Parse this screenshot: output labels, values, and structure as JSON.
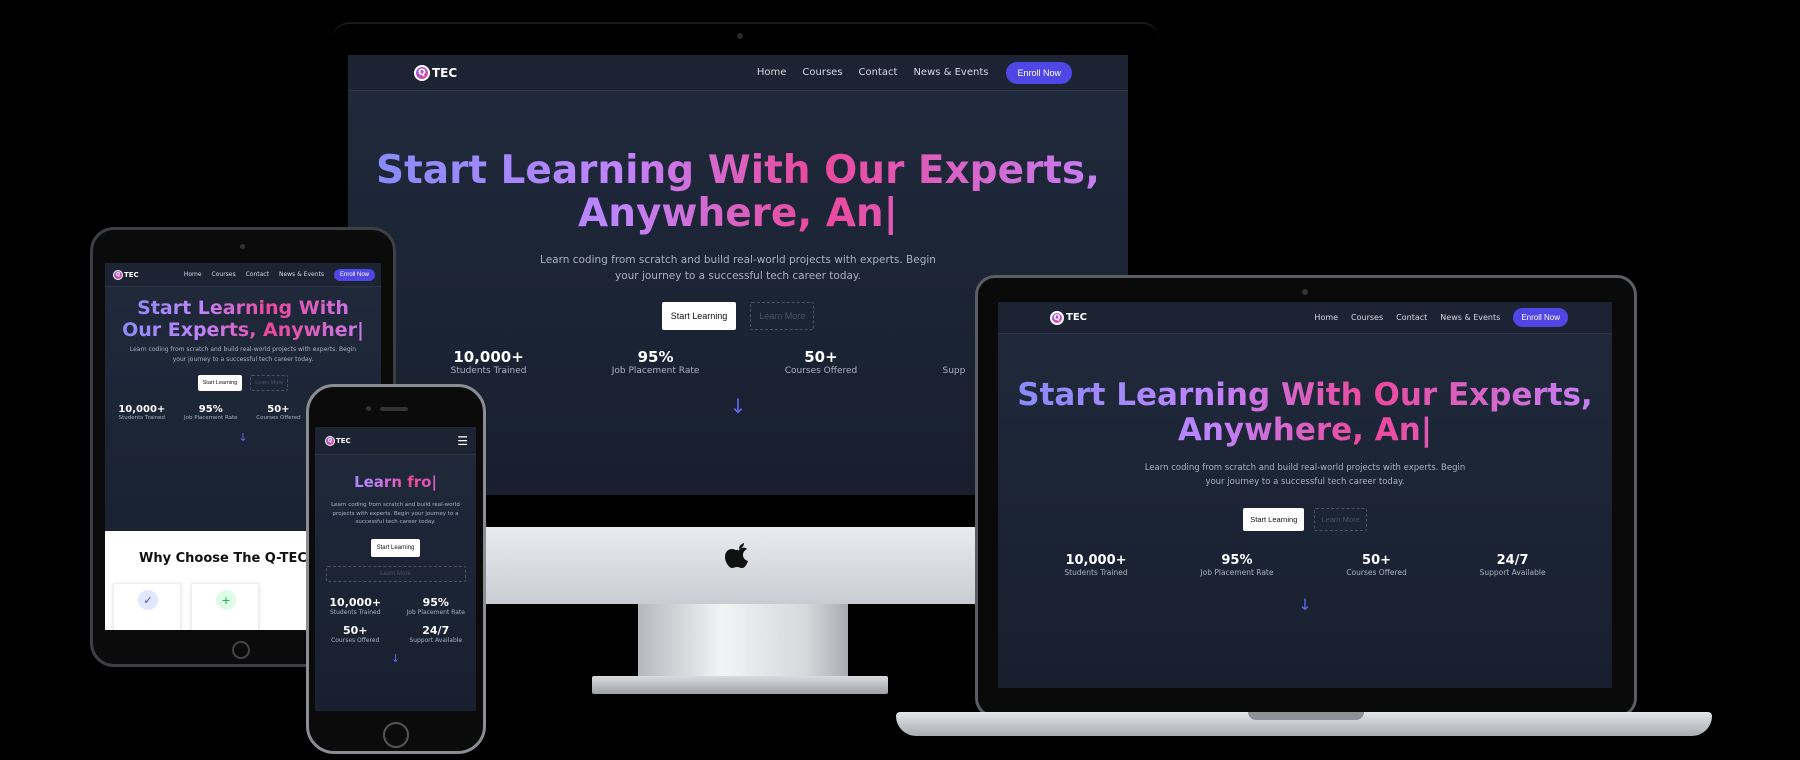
{
  "site": {
    "logo_text": "TEC",
    "logo_letter": "Q",
    "nav": [
      "Home",
      "Courses",
      "Contact",
      "News & Events"
    ],
    "enroll_label": "Enroll Now",
    "hero_full": "Start Learning With Our Experts, Anywhere, An|",
    "hero_line1": "Start Learning With Our Experts,",
    "hero_line2": "Anywhere, An|",
    "tablet_line1": "Start Learning With",
    "tablet_line2": "Our Experts, Anywher|",
    "phone_title": "Learn fro|",
    "subtitle_line1": "Learn coding from scratch and build real-world projects with experts. Begin",
    "subtitle_line2": "your journey to a successful tech career today.",
    "phone_sub_1": "Learn coding from scratch and build real-world",
    "phone_sub_2": "projects with experts. Begin your journey to a",
    "phone_sub_3": "successful tech career today.",
    "start_label": "Start Learning",
    "learn_more_label": "Learn More",
    "stats": [
      {
        "value": "10,000+",
        "label": "Students Trained"
      },
      {
        "value": "95%",
        "label": "Job Placement Rate"
      },
      {
        "value": "50+",
        "label": "Courses Offered"
      },
      {
        "value": "24/7",
        "label": "Support Available"
      }
    ],
    "imac_partial_label": "Supp",
    "why_heading": "Why Choose The Q-TEC Ma",
    "arrow": "↓",
    "hamburger": "☰",
    "check_icon": "✓",
    "plus_icon": "+"
  },
  "colors": {
    "accent": "#4f46e5",
    "gradient_start": "#818cf8",
    "gradient_mid": "#ec4899",
    "bg": "#1c2536"
  }
}
